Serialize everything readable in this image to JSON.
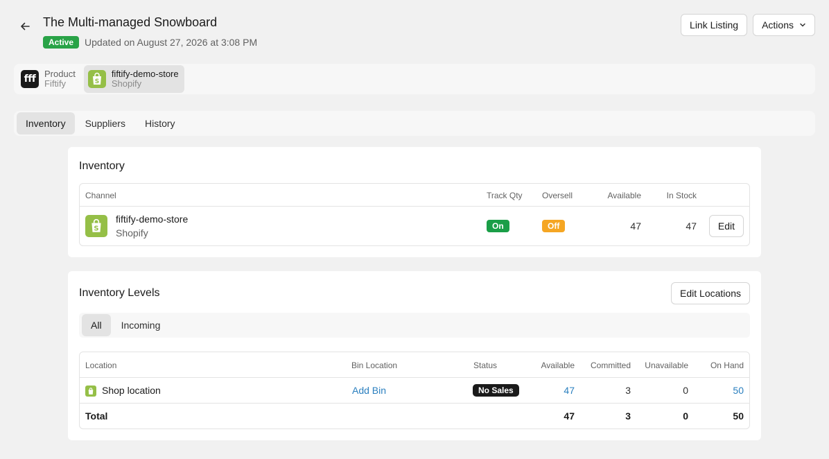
{
  "header": {
    "title": "The Multi-managed Snowboard",
    "status": "Active",
    "updated": "Updated on August 27, 2026 at 3:08 PM",
    "link_listing_label": "Link Listing",
    "actions_label": "Actions"
  },
  "channels": [
    {
      "name": "Product",
      "sub": "Fiftify",
      "logo_text": "fff"
    },
    {
      "name": "fiftify-demo-store",
      "sub": "Shopify"
    }
  ],
  "tabs": [
    {
      "label": "Inventory"
    },
    {
      "label": "Suppliers"
    },
    {
      "label": "History"
    }
  ],
  "inventory": {
    "title": "Inventory",
    "headers": {
      "channel": "Channel",
      "track_qty": "Track Qty",
      "oversell": "Oversell",
      "available": "Available",
      "in_stock": "In Stock"
    },
    "rows": [
      {
        "store": "fiftify-demo-store",
        "platform": "Shopify",
        "track_qty": "On",
        "oversell": "Off",
        "available": "47",
        "in_stock": "47",
        "edit_label": "Edit"
      }
    ]
  },
  "levels": {
    "title": "Inventory Levels",
    "edit_locations_label": "Edit Locations",
    "subtabs": [
      {
        "label": "All"
      },
      {
        "label": "Incoming"
      }
    ],
    "headers": {
      "location": "Location",
      "bin": "Bin Location",
      "status": "Status",
      "available": "Available",
      "committed": "Committed",
      "unavailable": "Unavailable",
      "on_hand": "On Hand"
    },
    "rows": [
      {
        "location": "Shop location",
        "bin": "Add Bin",
        "status": "No Sales",
        "available": "47",
        "committed": "3",
        "unavailable": "0",
        "on_hand": "50"
      }
    ],
    "total": {
      "label": "Total",
      "available": "47",
      "committed": "3",
      "unavailable": "0",
      "on_hand": "50"
    }
  },
  "colors": {
    "active_badge": "#29a347",
    "on_pill": "#1a9e47",
    "off_pill": "#f5a623",
    "link": "#2a7fbf",
    "shopify": "#95bf47"
  }
}
